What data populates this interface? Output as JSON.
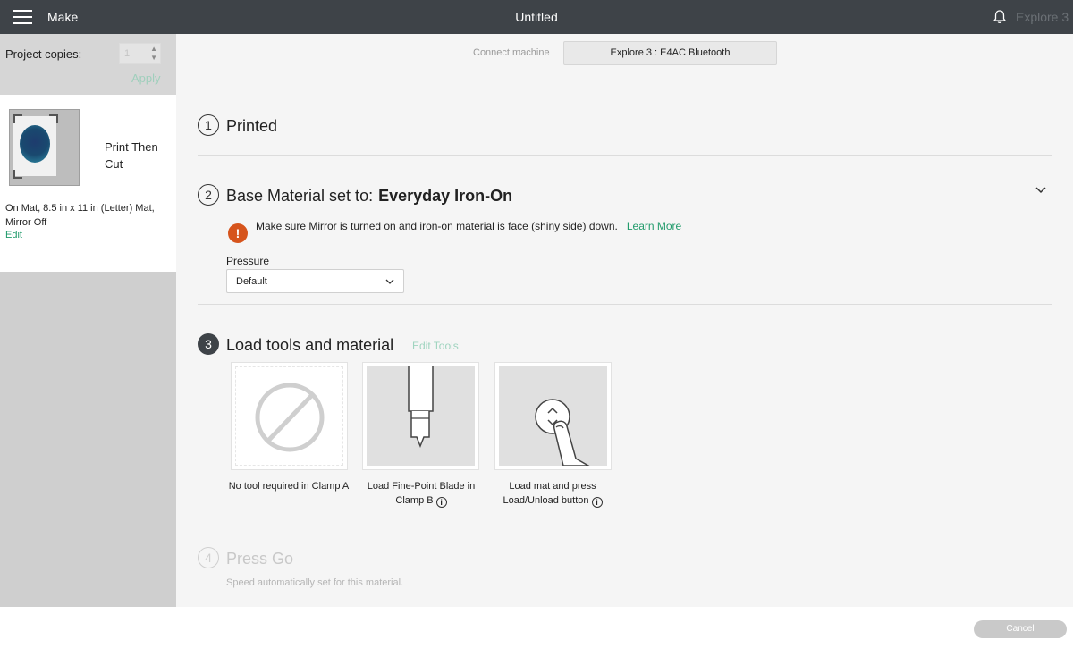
{
  "header": {
    "app_title": "Make",
    "document_title": "Untitled",
    "machine_name": "Explore 3",
    "menu_icon": "hamburger-icon",
    "notification_icon": "bell-icon"
  },
  "sidebar": {
    "copies_label": "Project copies:",
    "copies_value": "1",
    "apply_label": "Apply",
    "mat_label": "Print Then Cut",
    "mat_info": "On Mat, 8.5 in x 11 in (Letter) Mat, Mirror Off",
    "edit_label": "Edit"
  },
  "connect": {
    "label": "Connect machine",
    "machine_button": "Explore 3 : E4AC Bluetooth"
  },
  "steps": {
    "step1": {
      "number": "1",
      "title": "Printed"
    },
    "step2": {
      "number": "2",
      "title": "Base Material set to:",
      "material": "Everyday Iron-On",
      "warning": "Make sure Mirror is turned on and iron-on material is face (shiny side) down.",
      "learn_more": "Learn More",
      "pressure_label": "Pressure",
      "pressure_value": "Default"
    },
    "step3": {
      "number": "3",
      "title": "Load tools and material",
      "edit_tools": "Edit Tools",
      "tools": [
        {
          "label": "No tool required in Clamp A"
        },
        {
          "label": "Load Fine-Point Blade in Clamp B"
        },
        {
          "label": "Load mat and press Load/Unload button"
        }
      ]
    },
    "step4": {
      "number": "4",
      "title": "Press Go",
      "subtitle": "Speed automatically set for this material."
    }
  },
  "footer": {
    "cancel_label": "Cancel"
  },
  "colors": {
    "header_bg": "#3e4348",
    "accent_green": "#1f9a6a",
    "warning_orange": "#d6541c"
  }
}
